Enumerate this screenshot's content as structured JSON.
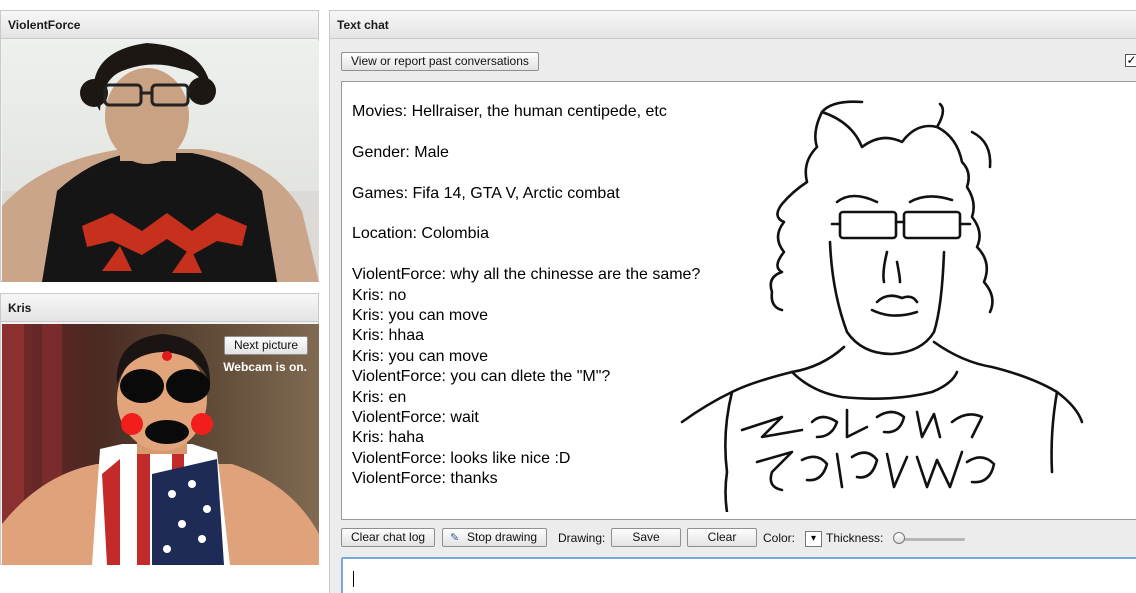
{
  "left_panels": {
    "top": {
      "title": "ViolentForce"
    },
    "bottom": {
      "title": "Kris",
      "next_picture_label": "Next picture",
      "webcam_status": "Webcam is on."
    }
  },
  "chat": {
    "title": "Text chat",
    "view_report_label": "View or report past conversations",
    "checkbox_checked": true,
    "profile": [
      "Movies: Hellraiser, the human centipede, etc",
      "Gender: Male",
      "Games: Fifa 14, GTA V, Arctic combat",
      "Location: Colombia"
    ],
    "messages": [
      "ViolentForce: why all the chinesse are the same?",
      "Kris: no",
      "Kris: you can move",
      "Kris: hhaa",
      "Kris: you can move",
      "ViolentForce: you can dlete the \"M\"?",
      "Kris: en",
      "ViolentForce: wait",
      "Kris: haha",
      "ViolentForce: looks like nice :D",
      "ViolentForce: thanks"
    ],
    "toolbar": {
      "clear_log_label": "Clear chat log",
      "stop_drawing_label": "Stop drawing",
      "drawing_label": "Drawing:",
      "save_label": "Save",
      "clear_label": "Clear",
      "color_label": "Color:",
      "thickness_label": "Thickness:",
      "thickness_value": 0.05
    },
    "input": {
      "value": ""
    }
  },
  "colors": {
    "panel_header": "#e8e8e8",
    "input_focus": "#7aa7e0",
    "drawing_stroke": "#111111"
  }
}
